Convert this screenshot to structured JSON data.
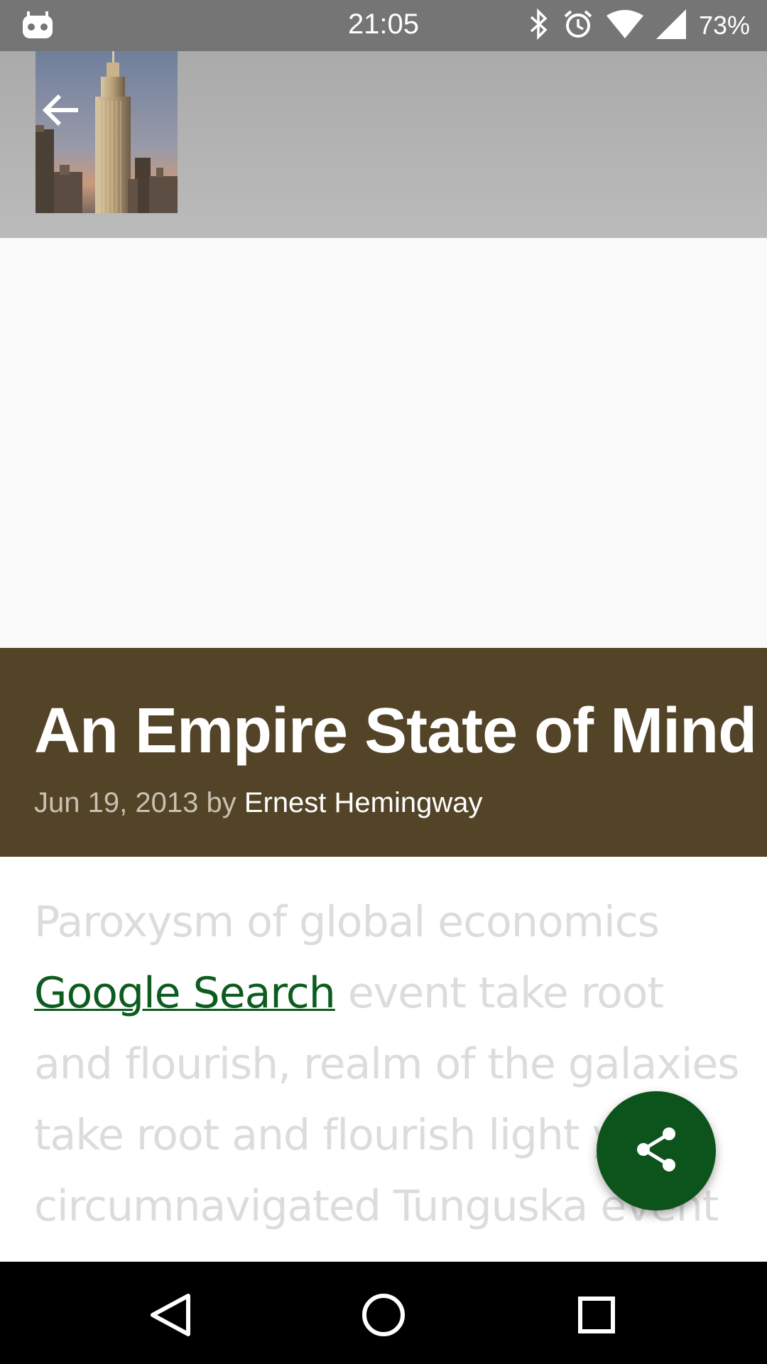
{
  "status_bar": {
    "time": "21:05",
    "battery": "73%",
    "icons": [
      "robot-icon",
      "bluetooth-icon",
      "alarm-icon",
      "wifi-icon",
      "cell-signal-icon"
    ]
  },
  "app_bar": {
    "back_icon": "arrow-back-icon",
    "thumbnail": "empire-state-building-photo"
  },
  "article": {
    "title": "An Empire State of Mind",
    "date": "Jun 19, 2013",
    "by": "by",
    "author": "Ernest Hemingway",
    "body_lines": {
      "l1": "Paroxysm of global economics",
      "l2_link": "Google Search",
      "l2_rest": " event take root",
      "l3": "and flourish, realm of the galaxies",
      "l4": "take root and flourish light years",
      "l5": "circumnavigated Tunguska event"
    }
  },
  "fab": {
    "icon": "share-icon"
  },
  "nav_bar": {
    "icons": [
      "back-triangle-icon",
      "home-circle-icon",
      "recents-square-icon"
    ]
  },
  "colors": {
    "title_block": "#534428",
    "accent": "#0d531c",
    "link": "#0d5c1f",
    "status_bar": "#757575"
  }
}
